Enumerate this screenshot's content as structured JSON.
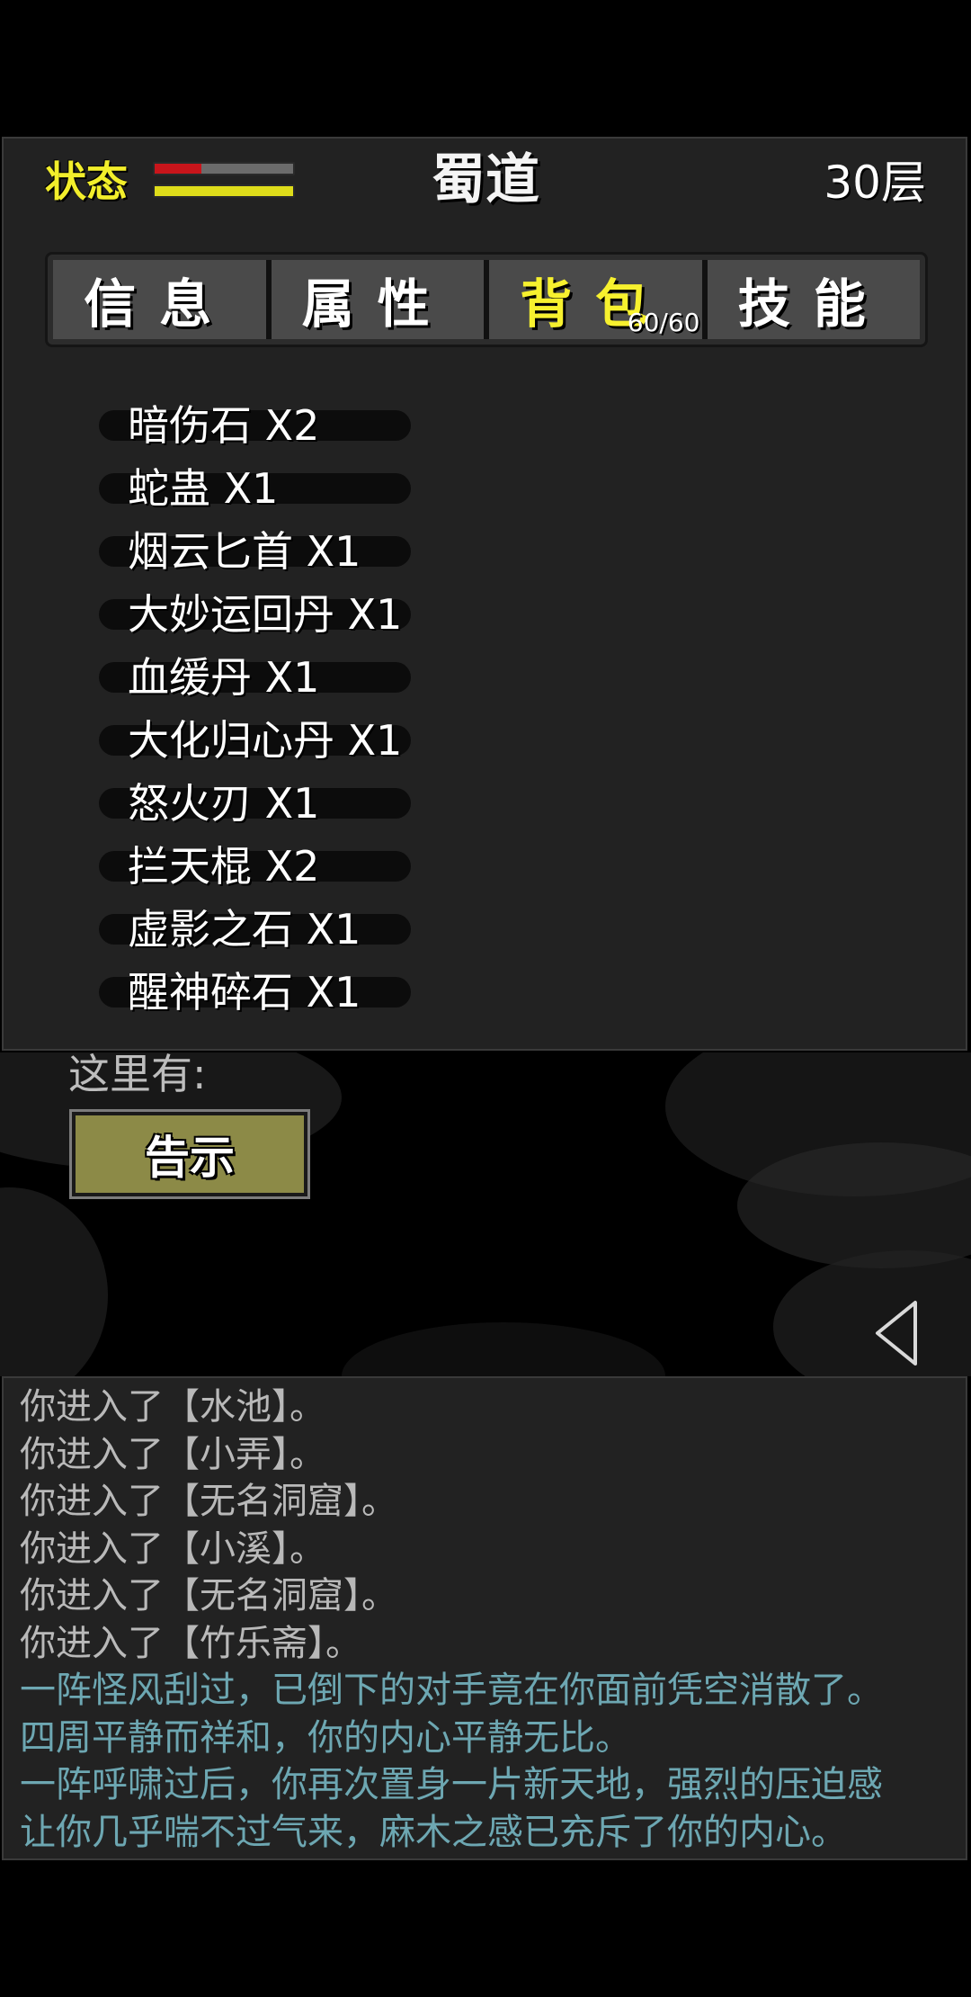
{
  "header": {
    "status_label": "状态",
    "hp_fraction": 0.34,
    "mp_fraction": 1.0,
    "hp_color": "#c8151b",
    "mp_color": "#dedc1a",
    "location": "蜀道",
    "floor": "30层"
  },
  "tabs": [
    {
      "label": "信息"
    },
    {
      "label": "属性"
    },
    {
      "label": "背包",
      "count": "60/60"
    },
    {
      "label": "技能"
    }
  ],
  "active_tab": 2,
  "inventory": [
    "暗伤石 X2",
    "蛇蛊 X1",
    "烟云匕首 X1",
    "大妙运回丹 X1",
    "血缓丹 X1",
    "大化归心丹 X1",
    "怒火刃 X1",
    "拦天棍 X2",
    "虚影之石 X1",
    "醒神碎石 X1"
  ],
  "scene": {
    "here_label": "这里有:",
    "notice_button": "告示",
    "back_icon": "left-triangle-icon"
  },
  "log": [
    {
      "text": "你进入了【水池】。",
      "kind": "system"
    },
    {
      "text": "你进入了【小弄】。",
      "kind": "system"
    },
    {
      "text": "你进入了【无名洞窟】。",
      "kind": "system"
    },
    {
      "text": "你进入了【小溪】。",
      "kind": "system"
    },
    {
      "text": "你进入了【无名洞窟】。",
      "kind": "system"
    },
    {
      "text": "你进入了【竹乐斋】。",
      "kind": "system"
    },
    {
      "text": "一阵怪风刮过，已倒下的对手竟在你面前凭空消散了。",
      "kind": "event"
    },
    {
      "text": "四周平静而祥和，你的内心平静无比。",
      "kind": "event"
    },
    {
      "text": "一阵呼啸过后，你再次置身一片新天地，强烈的压迫感",
      "kind": "event"
    },
    {
      "text": "让你几乎喘不过气来，麻木之感已充斥了你的内心。",
      "kind": "event"
    }
  ]
}
